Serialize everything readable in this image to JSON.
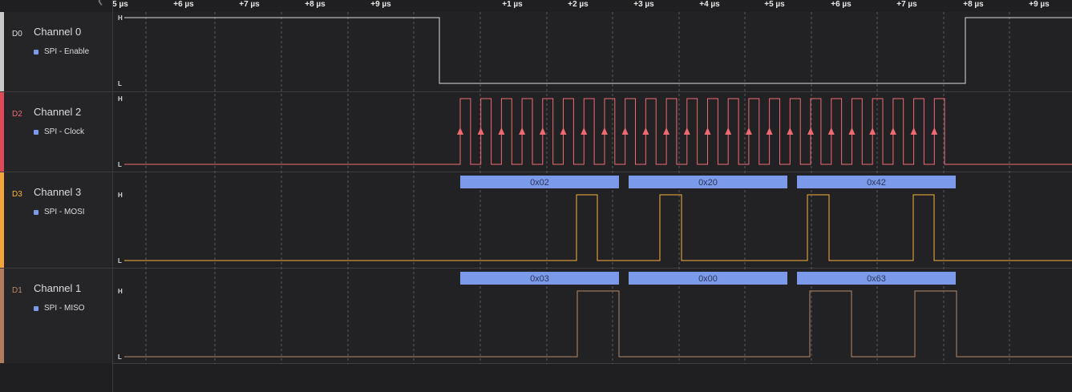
{
  "ruler": {
    "ticks": [
      "5 µs",
      "+6 µs",
      "+7 µs",
      "+8 µs",
      "+9 µs",
      "+1 µs",
      "+2 µs",
      "+3 µs",
      "+4 µs",
      "+5 µs",
      "+6 µs",
      "+7 µs",
      "+8 µs",
      "+9 µs"
    ]
  },
  "levels": {
    "high": "H",
    "low": "L"
  },
  "channels": [
    {
      "id": "D0",
      "name": "Channel 0",
      "analyzer": "SPI - Enable",
      "color": "#dcdcdc",
      "stripe": "#c9c9c9"
    },
    {
      "id": "D2",
      "name": "Channel 2",
      "analyzer": "SPI - Clock",
      "color": "#f06a72",
      "stripe": "#e04a58"
    },
    {
      "id": "D3",
      "name": "Channel 3",
      "analyzer": "SPI - MOSI",
      "color": "#f5b33c",
      "stripe": "#f2a33a"
    },
    {
      "id": "D1",
      "name": "Channel 1",
      "analyzer": "SPI - MISO",
      "color": "#b88a68",
      "stripe": "#b07d5c"
    }
  ],
  "decoded": {
    "mosi": [
      "0x02",
      "0x20",
      "0x42"
    ],
    "miso": [
      "0x03",
      "0x00",
      "0x63"
    ]
  },
  "colors": {
    "decode_bar": "#7b9bea",
    "grid": "#5a5a5e"
  }
}
